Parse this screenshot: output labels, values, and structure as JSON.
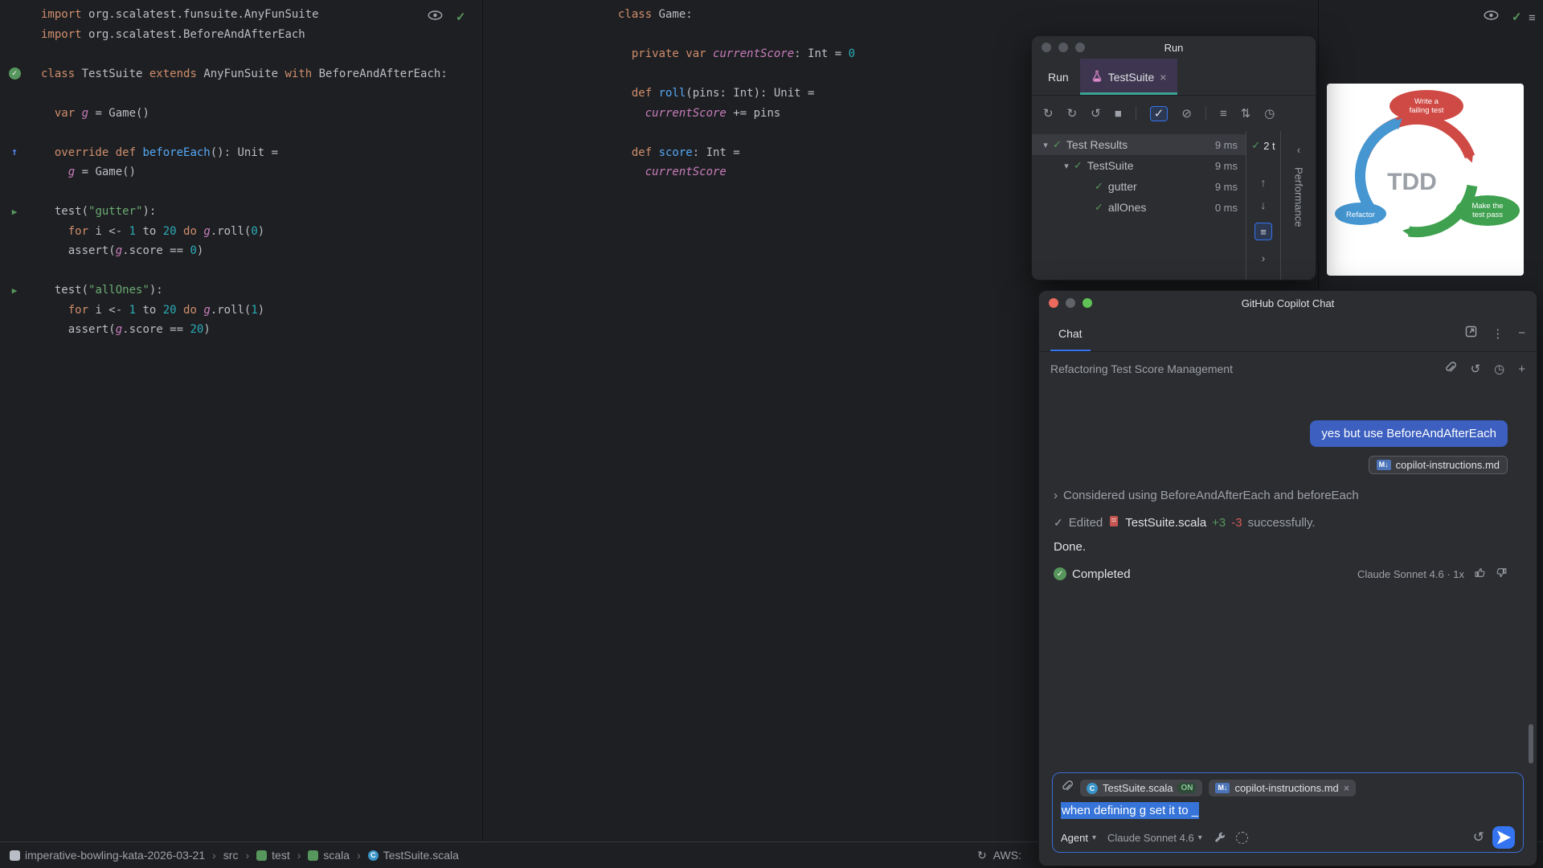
{
  "icons": {
    "check": "✓",
    "run_arrow": "▶",
    "arrow_up": "↑",
    "arrow_down": "↓",
    "chevron_expanded": "▾",
    "chevron_right": "›",
    "chevron_left": "‹",
    "dropdown": "▾",
    "close": "×",
    "kebab": "⋮",
    "minus": "−",
    "plus": "+",
    "undo": "↺",
    "history": "◷",
    "resend": "↺",
    "hamburger": "≡",
    "list": "≡",
    "sync": "↻",
    "md_badge": "M↓",
    "class_letter": "C"
  },
  "editor_left": {
    "lines": [
      {
        "indent": 0,
        "tokens": [
          {
            "t": "import ",
            "c": "k"
          },
          {
            "t": "org.scalatest.funsuite.AnyFunSuite",
            "c": "d"
          }
        ]
      },
      {
        "indent": 0,
        "tokens": [
          {
            "t": "import ",
            "c": "k"
          },
          {
            "t": "org.scalatest.BeforeAndAfterEach",
            "c": "d"
          }
        ]
      },
      {
        "tokens": []
      },
      {
        "icon": "test-passed-icon",
        "indent": 0,
        "tokens": [
          {
            "t": "class ",
            "c": "k"
          },
          {
            "t": "TestSuite ",
            "c": "d"
          },
          {
            "t": "extends ",
            "c": "k"
          },
          {
            "t": "AnyFunSuite ",
            "c": "d"
          },
          {
            "t": "with ",
            "c": "k"
          },
          {
            "t": "BeforeAndAfterEach:",
            "c": "d"
          }
        ]
      },
      {
        "tokens": []
      },
      {
        "indent": 2,
        "tokens": [
          {
            "t": "var ",
            "c": "k"
          },
          {
            "t": "g",
            "c": "f"
          },
          {
            "t": " = Game()",
            "c": "d"
          }
        ]
      },
      {
        "tokens": []
      },
      {
        "icon": "override-icon",
        "indent": 2,
        "tokens": [
          {
            "t": "override ",
            "c": "k"
          },
          {
            "t": "def ",
            "c": "k"
          },
          {
            "t": "beforeEach",
            "c": "m"
          },
          {
            "t": "(): Unit =",
            "c": "d"
          }
        ]
      },
      {
        "indent": 4,
        "tokens": [
          {
            "t": "g",
            "c": "f"
          },
          {
            "t": " = Game()",
            "c": "d"
          }
        ]
      },
      {
        "tokens": []
      },
      {
        "icon": "run-test-icon",
        "indent": 2,
        "tokens": [
          {
            "t": "test(",
            "c": "d"
          },
          {
            "t": "\"gutter\"",
            "c": "s"
          },
          {
            "t": "):",
            "c": "d"
          }
        ]
      },
      {
        "indent": 4,
        "tokens": [
          {
            "t": "for ",
            "c": "k"
          },
          {
            "t": "i <- ",
            "c": "d"
          },
          {
            "t": "1",
            "c": "n"
          },
          {
            "t": " to ",
            "c": "d"
          },
          {
            "t": "20",
            "c": "n"
          },
          {
            "t": " do ",
            "c": "k"
          },
          {
            "t": "g",
            "c": "f"
          },
          {
            "t": ".roll(",
            "c": "d"
          },
          {
            "t": "0",
            "c": "n"
          },
          {
            "t": ")",
            "c": "d"
          }
        ]
      },
      {
        "indent": 4,
        "tokens": [
          {
            "t": "assert(",
            "c": "d"
          },
          {
            "t": "g",
            "c": "f"
          },
          {
            "t": ".score == ",
            "c": "d"
          },
          {
            "t": "0",
            "c": "n"
          },
          {
            "t": ")",
            "c": "d"
          }
        ]
      },
      {
        "tokens": []
      },
      {
        "icon": "run-test-icon",
        "indent": 2,
        "tokens": [
          {
            "t": "test(",
            "c": "d"
          },
          {
            "t": "\"allOnes\"",
            "c": "s"
          },
          {
            "t": "):",
            "c": "d"
          }
        ]
      },
      {
        "indent": 4,
        "tokens": [
          {
            "t": "for ",
            "c": "k"
          },
          {
            "t": "i <- ",
            "c": "d"
          },
          {
            "t": "1",
            "c": "n"
          },
          {
            "t": " to ",
            "c": "d"
          },
          {
            "t": "20",
            "c": "n"
          },
          {
            "t": " do ",
            "c": "k"
          },
          {
            "t": "g",
            "c": "f"
          },
          {
            "t": ".roll(",
            "c": "d"
          },
          {
            "t": "1",
            "c": "n"
          },
          {
            "t": ")",
            "c": "d"
          }
        ]
      },
      {
        "indent": 4,
        "tokens": [
          {
            "t": "assert(",
            "c": "d"
          },
          {
            "t": "g",
            "c": "f"
          },
          {
            "t": ".score == ",
            "c": "d"
          },
          {
            "t": "20",
            "c": "n"
          },
          {
            "t": ")",
            "c": "d"
          }
        ]
      }
    ]
  },
  "editor_middle": {
    "lines": [
      {
        "indent": 0,
        "tokens": [
          {
            "t": "class ",
            "c": "k"
          },
          {
            "t": "Game:",
            "c": "d"
          }
        ]
      },
      {
        "tokens": []
      },
      {
        "indent": 2,
        "tokens": [
          {
            "t": "private ",
            "c": "k"
          },
          {
            "t": "var ",
            "c": "k"
          },
          {
            "t": "currentScore",
            "c": "f"
          },
          {
            "t": ": Int = ",
            "c": "d"
          },
          {
            "t": "0",
            "c": "n"
          }
        ]
      },
      {
        "tokens": []
      },
      {
        "indent": 2,
        "tokens": [
          {
            "t": "def ",
            "c": "k"
          },
          {
            "t": "roll",
            "c": "m"
          },
          {
            "t": "(pins: Int): Unit =",
            "c": "d"
          }
        ]
      },
      {
        "indent": 4,
        "tokens": [
          {
            "t": "currentScore",
            "c": "f"
          },
          {
            "t": " += pins",
            "c": "d"
          }
        ]
      },
      {
        "tokens": []
      },
      {
        "indent": 2,
        "tokens": [
          {
            "t": "def ",
            "c": "k"
          },
          {
            "t": "score",
            "c": "m"
          },
          {
            "t": ": Int =",
            "c": "d"
          }
        ]
      },
      {
        "indent": 4,
        "tokens": [
          {
            "t": "currentScore",
            "c": "f"
          }
        ]
      }
    ]
  },
  "run_window": {
    "title": "Run",
    "tabs": [
      {
        "label": "Run"
      },
      {
        "label": "TestSuite"
      }
    ],
    "toolbar": [
      {
        "name": "rerun-tests-icon",
        "glyph": "↻"
      },
      {
        "name": "rerun-failed-tests-icon",
        "glyph": "↻"
      },
      {
        "name": "toggle-auto-test-icon",
        "glyph": "↺"
      },
      {
        "name": "stop-icon",
        "glyph": "■"
      },
      {
        "sep": true
      },
      {
        "name": "show-passed-icon",
        "glyph": "✓",
        "active": true
      },
      {
        "name": "show-ignored-icon",
        "glyph": "⊘"
      },
      {
        "sep": true
      },
      {
        "name": "sort-by-duration-icon",
        "glyph": "≡"
      },
      {
        "name": "expand-collapse-icon",
        "glyph": "⇅"
      },
      {
        "name": "test-history-icon",
        "glyph": "◷"
      }
    ],
    "tree": [
      {
        "level": 0,
        "expanded": true,
        "selected": true,
        "label": "Test Results",
        "duration": "9 ms"
      },
      {
        "level": 1,
        "expanded": true,
        "label": "TestSuite",
        "duration": "9 ms"
      },
      {
        "level": 2,
        "label": "gutter",
        "duration": "9 ms"
      },
      {
        "level": 2,
        "label": "allOnes",
        "duration": "0 ms"
      }
    ],
    "summary_count": "2 t",
    "stripe_label": "Performance"
  },
  "tdd_diagram": {
    "center_label": "TDD",
    "steps": [
      {
        "label_line1": "Write a",
        "label_line2": "failing test",
        "color": "#CF4A45"
      },
      {
        "label_line1": "Make the",
        "label_line2": "test pass",
        "color": "#3FA14F"
      },
      {
        "label_line1": "Refactor",
        "label_line2": "",
        "color": "#4596D1"
      }
    ]
  },
  "copilot": {
    "window_title": "GitHub Copilot Chat",
    "tab_label": "Chat",
    "thread_title": "Refactoring Test Score Management",
    "user_message": "yes but use BeforeAndAfterEach",
    "attachment_chip": "copilot-instructions.md",
    "considered_text": "Considered using BeforeAndAfterEach and beforeEach",
    "edited": {
      "verb": "Edited",
      "file": "TestSuite.scala",
      "added": "+3",
      "removed": "-3",
      "suffix": "successfully."
    },
    "done_text": "Done.",
    "completed_text": "Completed",
    "model_usage": "Claude Sonnet 4.6 · 1x",
    "input": {
      "file_chip": "TestSuite.scala",
      "file_chip_badge": "ON",
      "md_chip": "copilot-instructions.md",
      "text": "when defining g set it to _",
      "mode": "Agent",
      "model": "Claude Sonnet 4.6"
    }
  },
  "status_bar": {
    "breadcrumbs": [
      {
        "label": "imperative-bowling-kata-2026-03-21",
        "icon": "project-icon"
      },
      {
        "label": "src",
        "icon": null
      },
      {
        "label": "test",
        "icon": "test-folder-icon"
      },
      {
        "label": "scala",
        "icon": "scala-folder-icon"
      },
      {
        "label": "TestSuite.scala",
        "icon": "scala-file-icon"
      }
    ],
    "right_label": "AWS:"
  }
}
